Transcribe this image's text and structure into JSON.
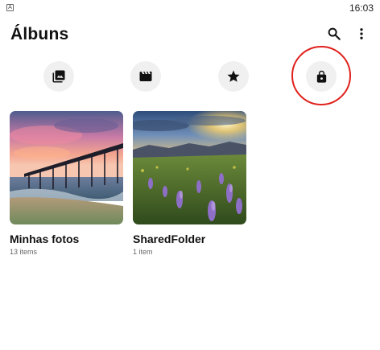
{
  "status_bar": {
    "app_glyph": "A",
    "time": "16:03"
  },
  "header": {
    "title": "Álbuns",
    "search_icon": "search-icon",
    "more_icon": "more-vert-icon"
  },
  "filters": [
    {
      "name": "photos",
      "icon": "photo-library-icon"
    },
    {
      "name": "videos",
      "icon": "movie-icon"
    },
    {
      "name": "favorites",
      "icon": "star-icon"
    },
    {
      "name": "locked",
      "icon": "lock-icon"
    }
  ],
  "highlight_color": "#e0201b",
  "albums": [
    {
      "name": "Minhas fotos",
      "count": "13 items",
      "thumbnail": "pier at sunset"
    },
    {
      "name": "SharedFolder",
      "count": "1 item",
      "thumbnail": "lupine flowers at sunrise"
    }
  ]
}
